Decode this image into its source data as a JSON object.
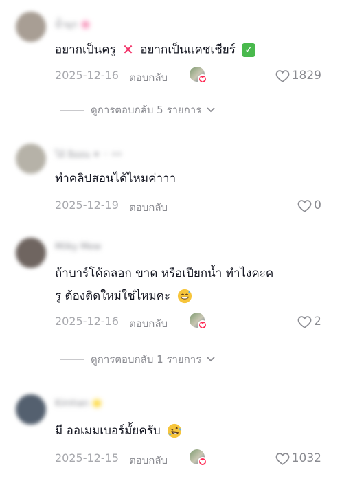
{
  "comments": [
    {
      "username": "น้ำมุก 🌸",
      "text_a": "อยากเป็นครู",
      "emoji_a": "✕",
      "text_b": "อยากเป็นแคชเชียร์",
      "emoji_b": "✓",
      "date": "2025-12-16",
      "reply_label": "ตอบกลับ",
      "likes": "1829",
      "replies_label": "ดูการตอบกลับ 5 รายการ",
      "avatar_color": "#a89e94"
    },
    {
      "username": "ไอ้ อิออน ✦ ·· ••",
      "text": "ทำคลิปสอนได้ไหมค่าาา",
      "date": "2025-12-19",
      "reply_label": "ตอบกลับ",
      "likes": "0",
      "avatar_color": "#b6b2a8"
    },
    {
      "username": "Milky Mew",
      "text_line1": "ถ้าบาร์โค้ดลอก ขาด หรือเปียกน้ำ ทำไงคะค",
      "text_line2": "รู ต้องติดใหม่ใช่ไหมคะ",
      "date": "2025-12-16",
      "reply_label": "ตอบกลับ",
      "likes": "2",
      "replies_label": "ดูการตอบกลับ 1 รายการ",
      "avatar_color": "#6f6560"
    },
    {
      "username": "Kimhan 🌟",
      "text": "มี ออเมมเบอร์มั้ยครับ",
      "date": "2025-12-15",
      "reply_label": "ตอบกลับ",
      "likes": "1032",
      "avatar_color": "#54606f"
    }
  ],
  "icons": {
    "like": "heart-outline-icon",
    "creator_liked": "heart-filled-icon",
    "expand": "chevron-down-icon"
  },
  "colors": {
    "text": "#161823",
    "secondary": "#8a8b91",
    "date": "#a7a8ad",
    "heart_badge": "#fe2c55",
    "x_emoji": "#f2356a",
    "check_emoji": "#49b94d"
  }
}
